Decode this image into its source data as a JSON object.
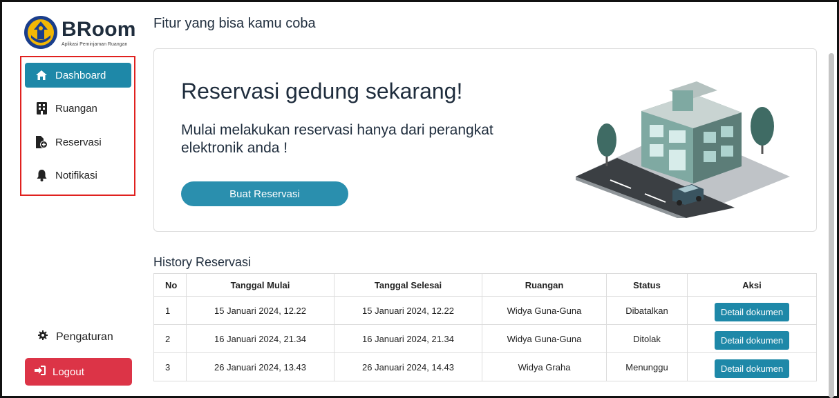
{
  "app": {
    "brand_name": "BRoom",
    "brand_subtitle": "Aplikasi Peminjaman Ruangan"
  },
  "sidebar": {
    "items": [
      {
        "label": "Dashboard",
        "icon": "home-icon",
        "active": true
      },
      {
        "label": "Ruangan",
        "icon": "building-icon",
        "active": false
      },
      {
        "label": "Reservasi",
        "icon": "file-plus-icon",
        "active": false
      },
      {
        "label": "Notifikasi",
        "icon": "bell-icon",
        "active": false
      }
    ],
    "settings_label": "Pengaturan",
    "logout_label": "Logout"
  },
  "main": {
    "page_title": "Fitur yang bisa kamu coba",
    "hero": {
      "title": "Reservasi gedung sekarang!",
      "description": "Mulai melakukan reservasi hanya dari perangkat elektronik anda !",
      "button_label": "Buat Reservasi"
    },
    "history": {
      "title": "History Reservasi",
      "columns": [
        "No",
        "Tanggal Mulai",
        "Tanggal Selesai",
        "Ruangan",
        "Status",
        "Aksi"
      ],
      "rows": [
        {
          "no": "1",
          "start": "15 Januari 2024, 12.22",
          "end": "15 Januari 2024, 12.22",
          "room": "Widya Guna-Guna",
          "status": "Dibatalkan",
          "action": "Detail dokumen"
        },
        {
          "no": "2",
          "start": "16 Januari 2024, 21.34",
          "end": "16 Januari 2024, 21.34",
          "room": "Widya Guna-Guna",
          "status": "Ditolak",
          "action": "Detail dokumen"
        },
        {
          "no": "3",
          "start": "26 Januari 2024, 13.43",
          "end": "26 Januari 2024, 14.43",
          "room": "Widya Graha",
          "status": "Menunggu",
          "action": "Detail dokumen"
        }
      ]
    }
  },
  "colors": {
    "primary": "#1e88a8",
    "danger": "#dc3447",
    "highlight_border": "#e0211f"
  }
}
